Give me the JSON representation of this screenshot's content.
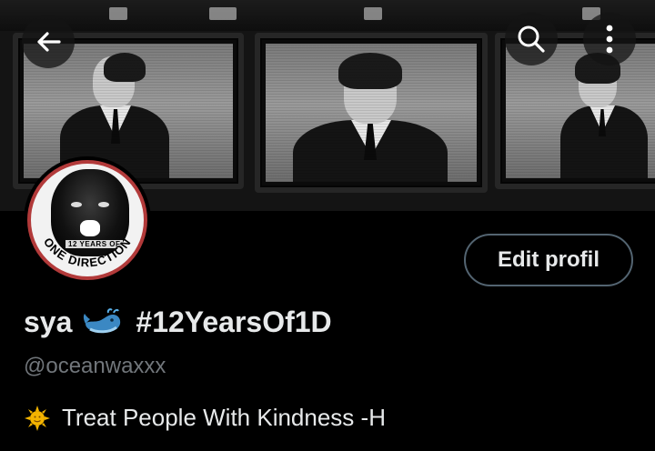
{
  "header": {
    "back_icon": "arrow-left-icon",
    "search_icon": "search-icon",
    "more_icon": "more-vertical-icon",
    "banner_description_icon": "banner-image"
  },
  "avatar": {
    "badge_small": "12 YEARS OF",
    "badge_arc": "ONE DIRECTION",
    "ring_color": "#b23a3a"
  },
  "profile": {
    "edit_button": "Edit profil",
    "name_prefix": "sya",
    "name_emoji_icon": "whale-icon",
    "name_suffix": "#12YearsOf1D",
    "handle": "@oceanwaxxx",
    "bio_emoji_icon": "sun-face-icon",
    "bio_text": "Treat People With Kindness -H"
  },
  "colors": {
    "background": "#000000",
    "text_primary": "#e7e9ea",
    "text_secondary": "#71767b",
    "button_border": "#536471"
  }
}
